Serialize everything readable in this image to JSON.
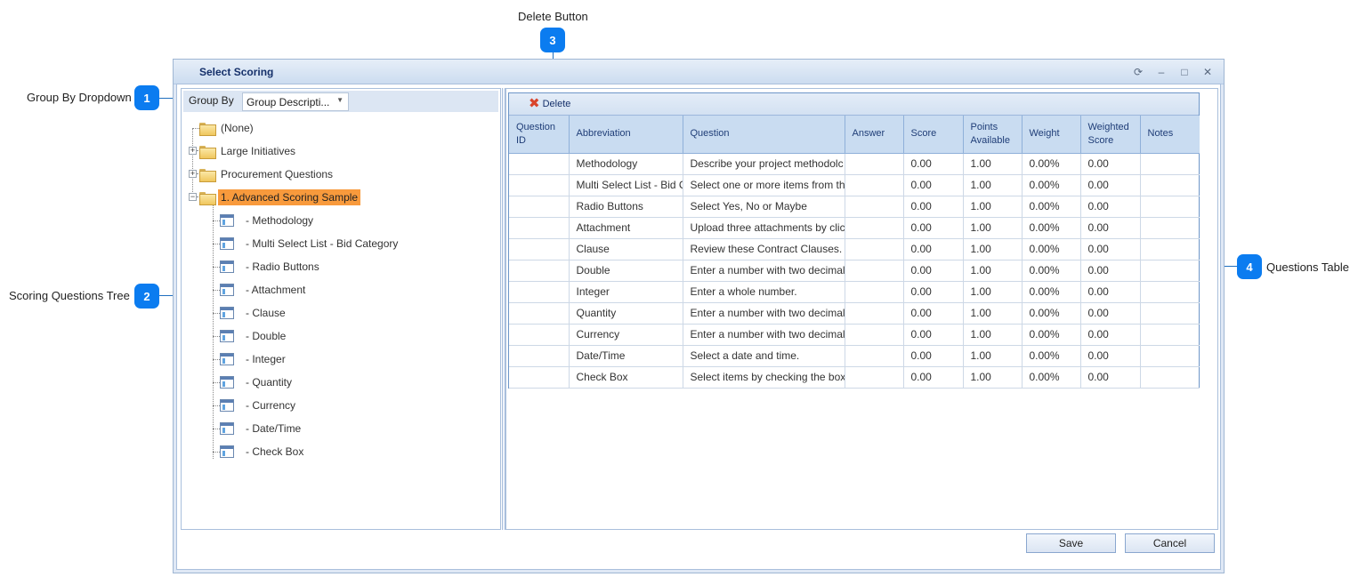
{
  "callouts": [
    {
      "number": "1",
      "label": "Group By Dropdown"
    },
    {
      "number": "2",
      "label": "Scoring Questions Tree"
    },
    {
      "number": "3",
      "label": "Delete Button"
    },
    {
      "number": "4",
      "label": "Questions Table"
    }
  ],
  "window": {
    "title": "Select Scoring",
    "controls": {
      "refresh": "⟳",
      "minimize": "–",
      "maximize": "□",
      "close": "✕"
    }
  },
  "groupby": {
    "label": "Group By",
    "selected": "Group Descripti...",
    "arrow": "▼"
  },
  "tree": {
    "groups": [
      {
        "label": "(None)",
        "expander": ""
      },
      {
        "label": "Large Initiatives",
        "expander": "+"
      },
      {
        "label": "Procurement Questions",
        "expander": "+"
      },
      {
        "label": "1. Advanced Scoring Sample",
        "expander": "−",
        "selected": true
      }
    ],
    "children": [
      "- Methodology",
      "- Multi Select List - Bid Category",
      "- Radio Buttons",
      "- Attachment",
      "- Clause",
      "- Double",
      "- Integer",
      "- Quantity",
      "- Currency",
      "- Date/Time",
      "- Check Box"
    ]
  },
  "toolbar": {
    "delete_label": "Delete",
    "delete_icon": "✖"
  },
  "table": {
    "columns": [
      "Question ID",
      "Abbreviation",
      "Question",
      "Answer",
      "Score",
      "Points Available",
      "Weight",
      "Weighted Score",
      "Notes"
    ],
    "rows": [
      {
        "id": "",
        "abbr": "Methodology",
        "question": "Describe your project methodolc",
        "answer": "",
        "score": "0.00",
        "points": "1.00",
        "weight": "0.00%",
        "wscore": "0.00",
        "notes": ""
      },
      {
        "id": "",
        "abbr": "Multi Select List - Bid C",
        "question": "Select one or more items from th",
        "answer": "",
        "score": "0.00",
        "points": "1.00",
        "weight": "0.00%",
        "wscore": "0.00",
        "notes": ""
      },
      {
        "id": "",
        "abbr": "Radio Buttons",
        "question": "Select Yes, No or Maybe",
        "answer": "",
        "score": "0.00",
        "points": "1.00",
        "weight": "0.00%",
        "wscore": "0.00",
        "notes": ""
      },
      {
        "id": "",
        "abbr": "Attachment",
        "question": "Upload three attachments by clic",
        "answer": "",
        "score": "0.00",
        "points": "1.00",
        "weight": "0.00%",
        "wscore": "0.00",
        "notes": ""
      },
      {
        "id": "",
        "abbr": "Clause",
        "question": "Review these Contract Clauses.",
        "answer": "",
        "score": "0.00",
        "points": "1.00",
        "weight": "0.00%",
        "wscore": "0.00",
        "notes": ""
      },
      {
        "id": "",
        "abbr": "Double",
        "question": "Enter a number with two decimal",
        "answer": "",
        "score": "0.00",
        "points": "1.00",
        "weight": "0.00%",
        "wscore": "0.00",
        "notes": ""
      },
      {
        "id": "",
        "abbr": "Integer",
        "question": "Enter a whole number.",
        "answer": "",
        "score": "0.00",
        "points": "1.00",
        "weight": "0.00%",
        "wscore": "0.00",
        "notes": ""
      },
      {
        "id": "",
        "abbr": "Quantity",
        "question": "Enter a number with two decimal",
        "answer": "",
        "score": "0.00",
        "points": "1.00",
        "weight": "0.00%",
        "wscore": "0.00",
        "notes": ""
      },
      {
        "id": "",
        "abbr": "Currency",
        "question": "Enter a number with two decimal",
        "answer": "",
        "score": "0.00",
        "points": "1.00",
        "weight": "0.00%",
        "wscore": "0.00",
        "notes": ""
      },
      {
        "id": "",
        "abbr": "Date/Time",
        "question": "Select a date and time.",
        "answer": "",
        "score": "0.00",
        "points": "1.00",
        "weight": "0.00%",
        "wscore": "0.00",
        "notes": ""
      },
      {
        "id": "",
        "abbr": "Check Box",
        "question": "Select items by checking the box",
        "answer": "",
        "score": "0.00",
        "points": "1.00",
        "weight": "0.00%",
        "wscore": "0.00",
        "notes": ""
      }
    ]
  },
  "footer": {
    "save_label": "Save",
    "cancel_label": "Cancel"
  }
}
